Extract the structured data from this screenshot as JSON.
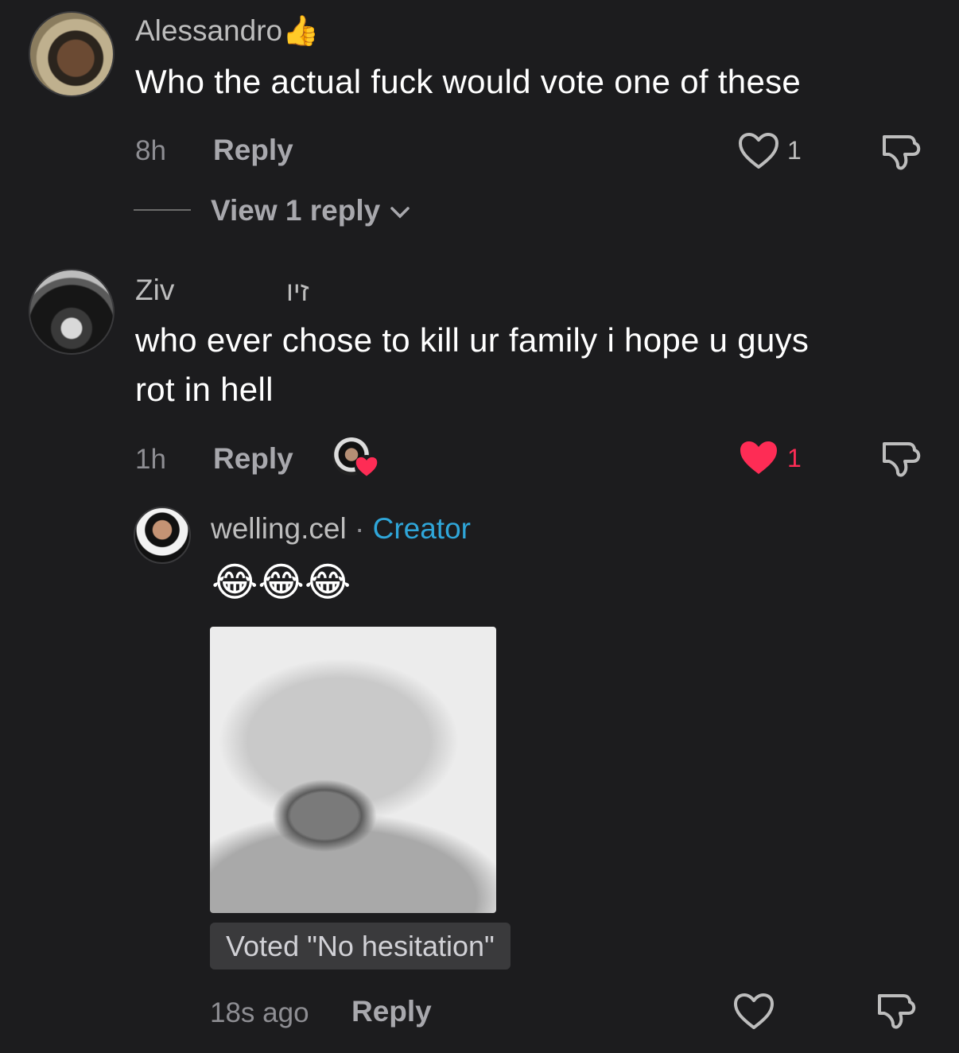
{
  "comments": [
    {
      "username": "Alessandro",
      "username_emoji": "👍",
      "text": "Who the actual fuck would vote one of these",
      "time": "8h",
      "reply_label": "Reply",
      "like_count": "1",
      "view_replies": "View 1 reply"
    },
    {
      "username": "Ziv",
      "username_extra": "זיו",
      "text_line1": "who ever chose to kill ur family i hope u guys",
      "text_line2": "rot in hell",
      "time": "1h",
      "reply_label": "Reply",
      "like_count": "1",
      "liked": true,
      "creator_liked": true
    }
  ],
  "reply": {
    "username": "welling.cel",
    "separator": "·",
    "badge": "Creator",
    "emoji_text": "😂😂😂",
    "vote_label": "Voted \"No hesitation\"",
    "time": "18s ago",
    "reply_label": "Reply"
  },
  "colors": {
    "background": "#1c1c1e",
    "liked_heart": "#fe2c55",
    "creator_badge": "#2fa6d9"
  },
  "icons": [
    "heart-outline-icon",
    "heart-filled-icon",
    "dislike-icon",
    "chevron-down-icon",
    "thumbs-up-emoji"
  ]
}
